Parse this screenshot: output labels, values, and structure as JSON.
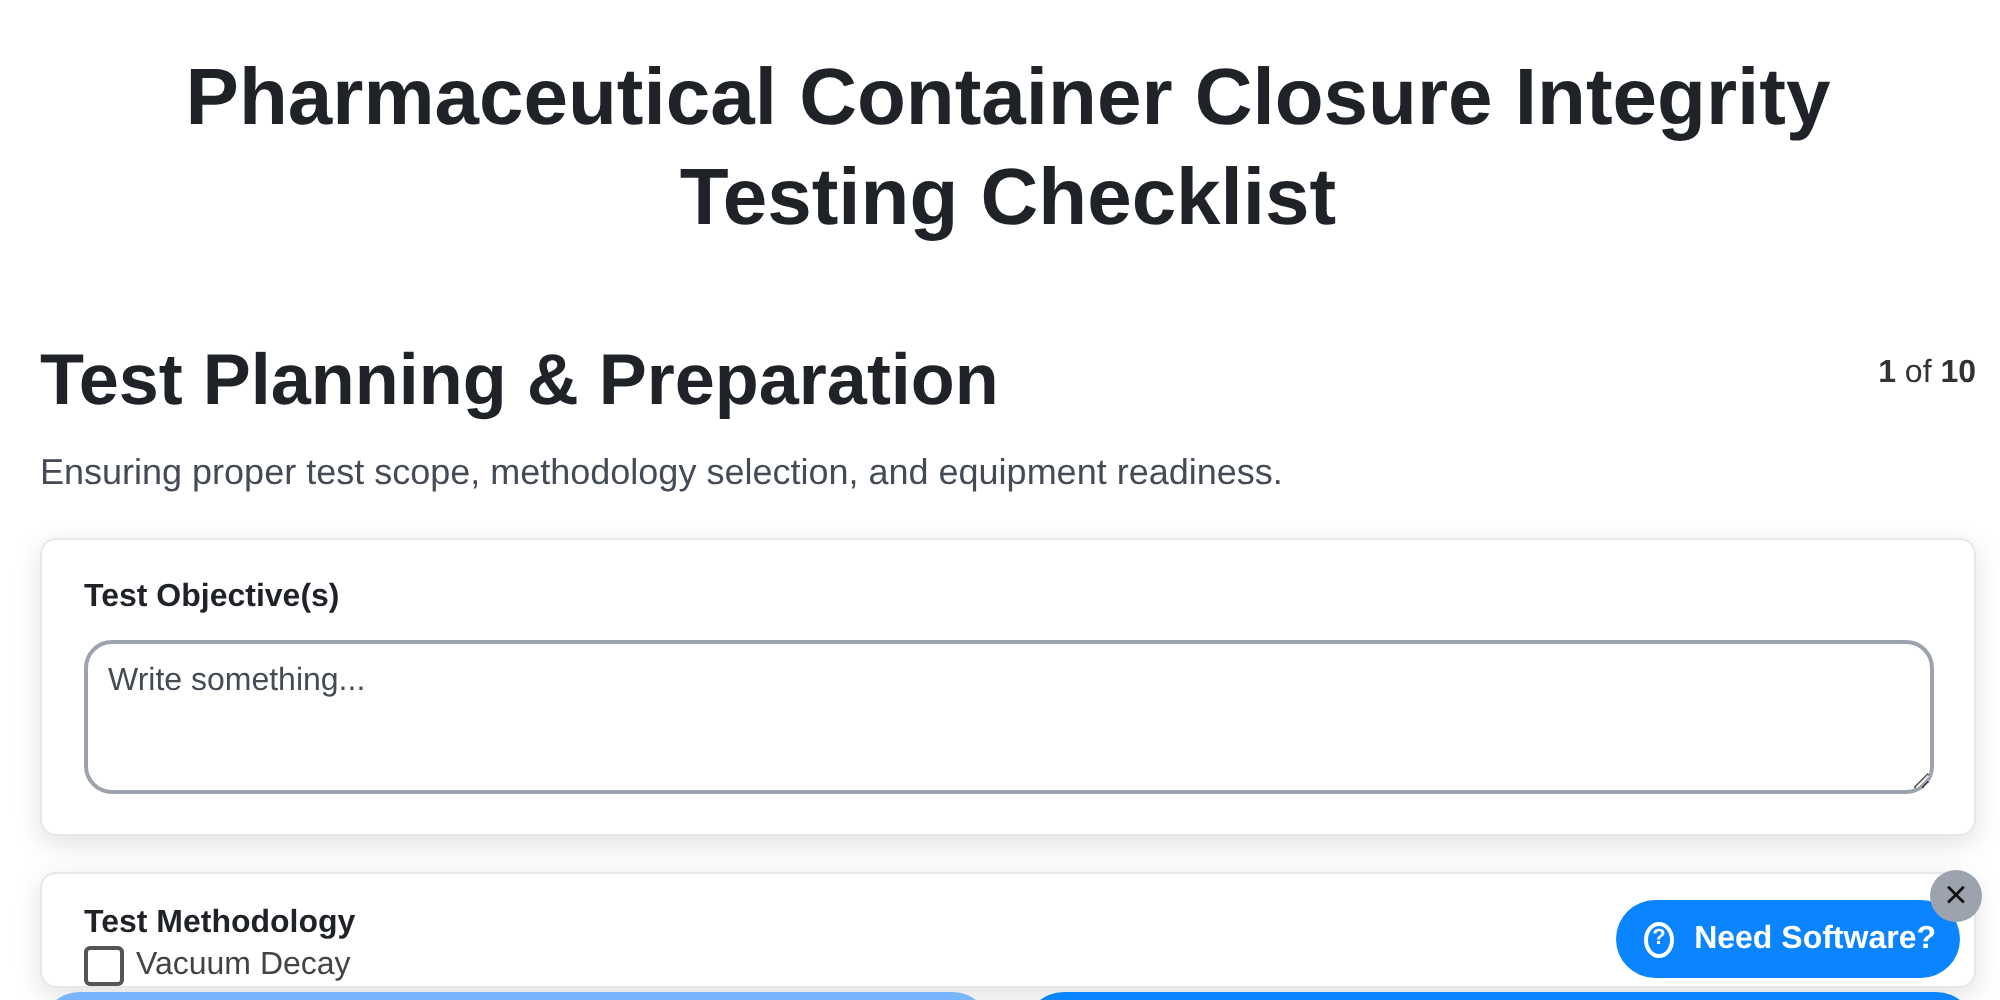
{
  "title": "Pharmaceutical Container Closure Integrity Testing Checklist",
  "section": {
    "title": "Test Planning & Preparation",
    "description": "Ensuring proper test scope, methodology selection, and equipment readiness.",
    "page": "1",
    "of": "of",
    "total": "10"
  },
  "objective": {
    "label": "Test Objective(s)",
    "placeholder": "Write something..."
  },
  "methodology": {
    "label": "Test Methodology",
    "options": [
      {
        "label": "Vacuum Decay",
        "checked": false
      }
    ]
  },
  "help_button": {
    "label": "Need Software?",
    "icon": "?"
  },
  "close_button": "×"
}
